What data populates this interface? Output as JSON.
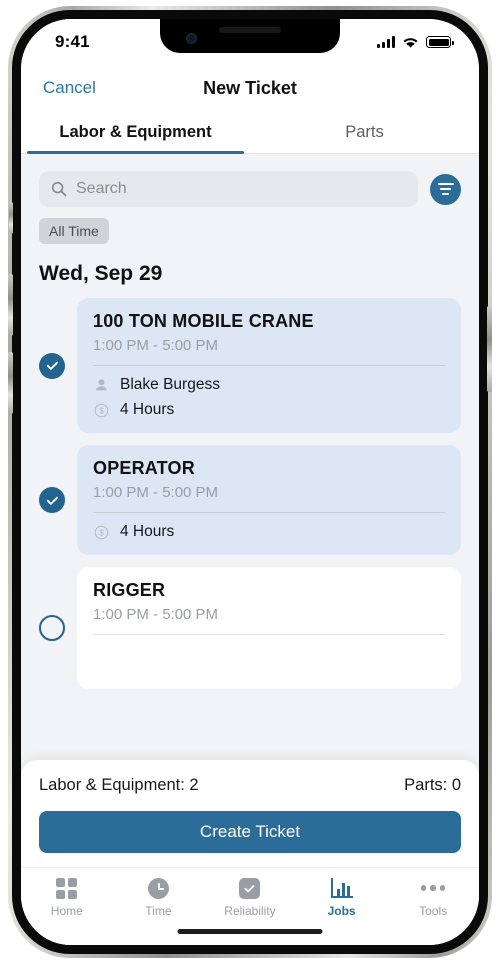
{
  "status_bar": {
    "time": "9:41",
    "signal_icon": "signal-bars-icon",
    "wifi_icon": "wifi-icon",
    "battery_icon": "battery-icon"
  },
  "nav": {
    "cancel_label": "Cancel",
    "title": "New Ticket"
  },
  "tabs": [
    {
      "label": "Labor & Equipment",
      "active": true
    },
    {
      "label": "Parts",
      "active": false
    }
  ],
  "search": {
    "placeholder": "Search",
    "value": "",
    "icon": "search-icon",
    "filter_icon": "filter-icon"
  },
  "filters": {
    "time_chip": "All Time"
  },
  "date_header": "Wed, Sep 29",
  "jobs": [
    {
      "title": "100 TON MOBILE CRANE",
      "time": "1:00 PM - 5:00 PM",
      "selected": true,
      "person": "Blake Burgess",
      "duration": "4 Hours"
    },
    {
      "title": "OPERATOR",
      "time": "1:00 PM - 5:00 PM",
      "selected": true,
      "person": "",
      "duration": "4 Hours"
    },
    {
      "title": "RIGGER",
      "time": "1:00 PM - 5:00 PM",
      "selected": false,
      "person": "",
      "duration": ""
    }
  ],
  "summary": {
    "labor_label": "Labor & Equipment: 2",
    "parts_label": "Parts: 0"
  },
  "create_button": "Create Ticket",
  "bottom_nav": [
    {
      "label": "Home",
      "icon": "grid-icon",
      "active": false
    },
    {
      "label": "Time",
      "icon": "clock-icon",
      "active": false
    },
    {
      "label": "Reliability",
      "icon": "checkbox-icon",
      "active": false
    },
    {
      "label": "Jobs",
      "icon": "bar-chart-icon",
      "active": true
    },
    {
      "label": "Tools",
      "icon": "ellipsis-icon",
      "active": false
    }
  ],
  "colors": {
    "accent": "#2b6d98",
    "link": "#2e76a8",
    "selected_card": "#dde6f4",
    "page_bg": "#f2f3f7"
  }
}
